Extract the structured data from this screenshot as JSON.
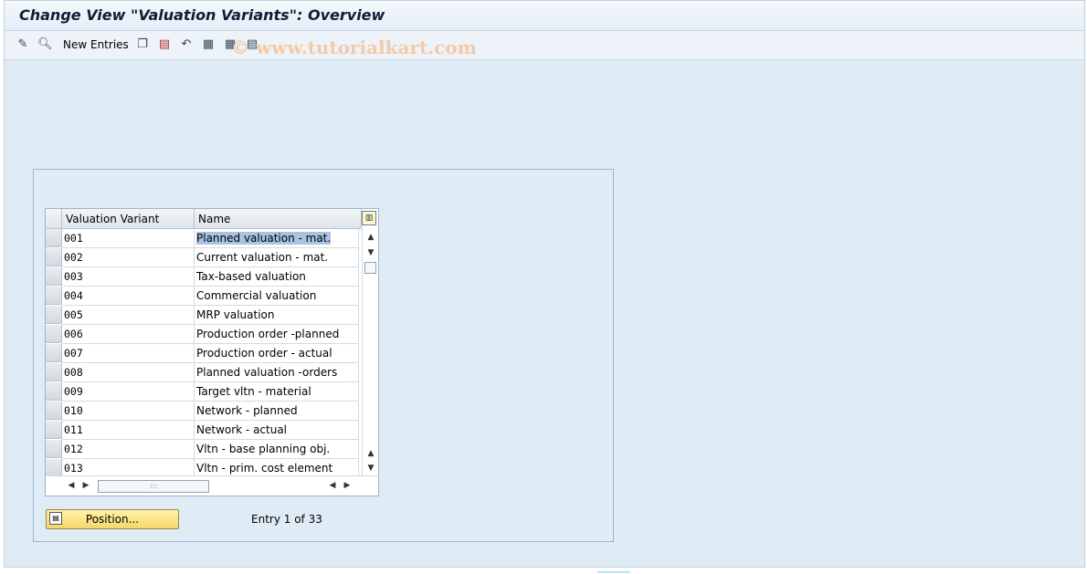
{
  "window": {
    "title": "Change View \"Valuation Variants\": Overview"
  },
  "toolbar": {
    "icons": [
      "edit-glasses-icon",
      "detail-icon"
    ],
    "new_entries_label": "New Entries",
    "icons2": [
      "copy-icon",
      "delete-icon",
      "undo-icon",
      "select-all-icon",
      "select-block-icon",
      "deselect-all-icon"
    ]
  },
  "watermark": "© www.tutorialkart.com",
  "table": {
    "columns": [
      "Valuation Variant",
      "Name"
    ],
    "rows": [
      {
        "code": "001",
        "name": "Planned valuation - mat."
      },
      {
        "code": "002",
        "name": "Current valuation - mat."
      },
      {
        "code": "003",
        "name": "Tax-based valuation"
      },
      {
        "code": "004",
        "name": "Commercial valuation"
      },
      {
        "code": "005",
        "name": "MRP valuation"
      },
      {
        "code": "006",
        "name": "Production order -planned"
      },
      {
        "code": "007",
        "name": "Production order - actual"
      },
      {
        "code": "008",
        "name": "Planned valuation -orders"
      },
      {
        "code": "009",
        "name": "Target vltn - material"
      },
      {
        "code": "010",
        "name": "Network - planned"
      },
      {
        "code": "011",
        "name": "Network - actual"
      },
      {
        "code": "012",
        "name": "Vltn - base planning obj."
      },
      {
        "code": "013",
        "name": "Vltn - prim. cost element"
      }
    ]
  },
  "position_button": {
    "label": "Position..."
  },
  "entry_info": "Entry 1 of 33"
}
